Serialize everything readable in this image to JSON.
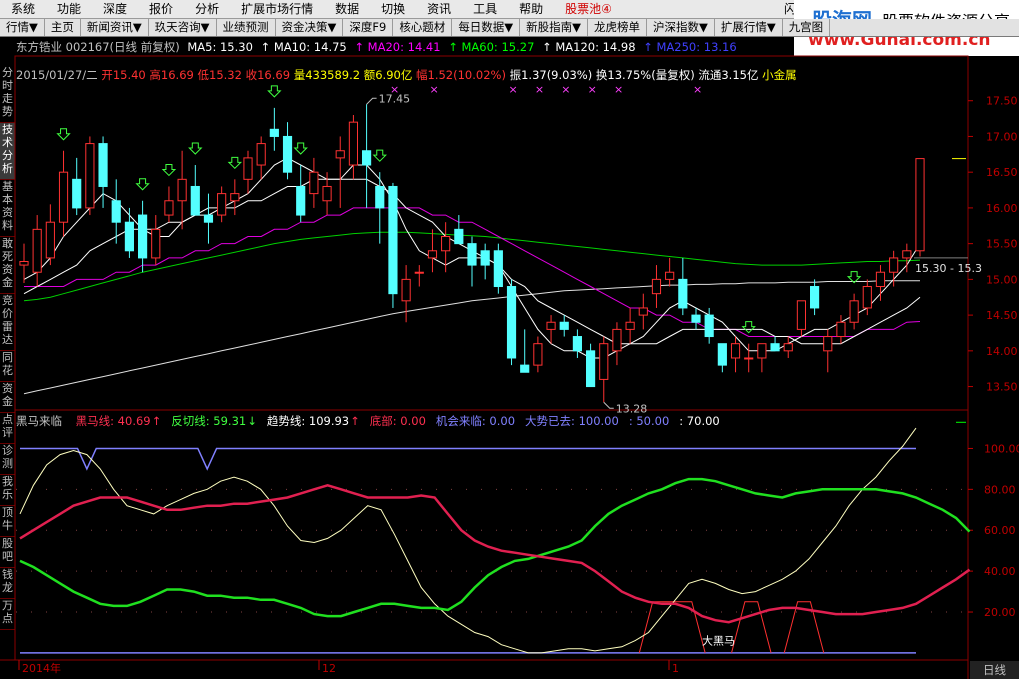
{
  "menubar": {
    "items": [
      "系统",
      "功能",
      "深度",
      "报价",
      "分析",
      "扩展市场行情",
      "数据",
      "切换",
      "资讯",
      "工具",
      "帮助"
    ],
    "stock_pool": "股票池④",
    "flash": "闪电手"
  },
  "logo": {
    "brand": "股海网",
    "tagline": "股票软件资源分享",
    "url": "www.Guhai.com.cn"
  },
  "toolbar": {
    "items": [
      "行情▼",
      "主页",
      "新闻资讯▼",
      "玖天咨询▼",
      "业绩预测",
      "资金决策▼",
      "深度F9",
      "核心题材",
      "每日数据▼",
      "新股指南▼",
      "龙虎榜单",
      "沪深指数▼",
      "扩展行情▼",
      "九宫图"
    ]
  },
  "main_header": {
    "stock": "东方锆业 002167(日线 前复权)",
    "ma": [
      {
        "label": "MA5: 15.30",
        "color": "#ffffff"
      },
      {
        "label": "MA10: 14.75",
        "color": "#ffffff"
      },
      {
        "label": "MA20: 14.41",
        "color": "#ff00ff"
      },
      {
        "label": "MA60: 15.27",
        "color": "#00ff00"
      },
      {
        "label": "MA120: 14.98",
        "color": "#ffffff"
      },
      {
        "label": "MA250: 13.16",
        "color": "#4040ff"
      }
    ]
  },
  "quote_line": {
    "date": "2015/01/27/二",
    "open": "开15.40",
    "high": "高16.69",
    "low": "低15.32",
    "close": "收16.69",
    "vol": "量433589.2",
    "amount": "额6.90亿",
    "change": "幅1.52(10.02%)",
    "amplitude": "振1.37(9.03%)",
    "turnover": "换13.75%(量复权)",
    "float": "流通3.15亿",
    "tag": "小金属"
  },
  "price_axis": [
    "17.50",
    "17.00",
    "16.50",
    "16.00",
    "15.50",
    "15.00",
    "14.50",
    "14.00",
    "13.50"
  ],
  "annotations": {
    "high_mark": "17.45",
    "low_mark": "13.28",
    "last_price": "15.30 - 15.3"
  },
  "indicator_header": {
    "name": "黑马来临",
    "items": [
      {
        "label": "黑马线: 40.69",
        "color": "#ff3050"
      },
      {
        "label": "↑",
        "color": "#ff3050"
      },
      {
        "label": "反切线: 59.31",
        "color": "#40ff40"
      },
      {
        "label": "↓",
        "color": "#40ff40"
      },
      {
        "label": "趋势线: 109.93",
        "color": "#ffffff"
      },
      {
        "label": "↑",
        "color": "#ff3050"
      },
      {
        "label": "底部: 0.00",
        "color": "#ff3050"
      },
      {
        "label": "机会来临: 0.00",
        "color": "#8080ff"
      },
      {
        "label": "大势已去: 100.00",
        "color": "#8080ff"
      },
      {
        "label": ": 50.00",
        "color": "#8080ff"
      },
      {
        "label": ": 70.00",
        "color": "#ffffff"
      }
    ]
  },
  "indicator_axis": [
    "100.00",
    "80.00",
    "60.00",
    "40.00",
    "20.00"
  ],
  "indicator_label": "大黑马",
  "date_axis": [
    "2014年",
    "12",
    "1"
  ],
  "bottom_tab": "日线",
  "sidebar": [
    "分时走势",
    "技术分析",
    "基本资料",
    "敢死资金",
    "竞价雷达",
    "同花",
    "资金",
    "点评",
    "诊测",
    "我乐",
    "顶牛",
    "股吧",
    "钱龙",
    "万点"
  ],
  "colors": {
    "up": "#ff3232",
    "down": "#54ffff",
    "grid": "#800000"
  },
  "chart_data": {
    "type": "candlestick",
    "price_range": [
      13.2,
      17.65
    ],
    "candles": [
      {
        "o": 15.2,
        "h": 15.5,
        "l": 14.95,
        "c": 15.25
      },
      {
        "o": 15.1,
        "h": 15.9,
        "l": 14.9,
        "c": 15.7
      },
      {
        "o": 15.3,
        "h": 16.05,
        "l": 15.2,
        "c": 15.8
      },
      {
        "o": 15.8,
        "h": 16.8,
        "l": 15.6,
        "c": 16.5
      },
      {
        "o": 16.4,
        "h": 16.7,
        "l": 15.9,
        "c": 16.0
      },
      {
        "o": 16.0,
        "h": 17.0,
        "l": 15.9,
        "c": 16.9
      },
      {
        "o": 16.9,
        "h": 17.0,
        "l": 16.0,
        "c": 16.3
      },
      {
        "o": 16.1,
        "h": 16.4,
        "l": 15.5,
        "c": 15.8
      },
      {
        "o": 15.8,
        "h": 16.0,
        "l": 15.3,
        "c": 15.4
      },
      {
        "o": 15.9,
        "h": 16.1,
        "l": 15.1,
        "c": 15.3
      },
      {
        "o": 15.3,
        "h": 15.9,
        "l": 15.2,
        "c": 15.7
      },
      {
        "o": 15.9,
        "h": 16.3,
        "l": 15.8,
        "c": 16.1
      },
      {
        "o": 16.1,
        "h": 16.8,
        "l": 15.7,
        "c": 16.4
      },
      {
        "o": 16.3,
        "h": 16.6,
        "l": 15.9,
        "c": 15.9
      },
      {
        "o": 15.9,
        "h": 16.2,
        "l": 15.5,
        "c": 15.8
      },
      {
        "o": 15.9,
        "h": 16.3,
        "l": 15.8,
        "c": 16.2
      },
      {
        "o": 16.1,
        "h": 16.4,
        "l": 15.9,
        "c": 16.2
      },
      {
        "o": 16.4,
        "h": 16.8,
        "l": 16.2,
        "c": 16.7
      },
      {
        "o": 16.6,
        "h": 17.0,
        "l": 16.4,
        "c": 16.9
      },
      {
        "o": 17.1,
        "h": 17.4,
        "l": 16.8,
        "c": 17.0
      },
      {
        "o": 17.0,
        "h": 17.2,
        "l": 16.4,
        "c": 16.5
      },
      {
        "o": 16.3,
        "h": 16.6,
        "l": 15.8,
        "c": 15.9
      },
      {
        "o": 16.2,
        "h": 16.7,
        "l": 16.0,
        "c": 16.5
      },
      {
        "o": 16.1,
        "h": 16.5,
        "l": 15.9,
        "c": 16.3
      },
      {
        "o": 16.7,
        "h": 17.0,
        "l": 16.0,
        "c": 16.8
      },
      {
        "o": 16.6,
        "h": 17.3,
        "l": 16.4,
        "c": 17.2
      },
      {
        "o": 16.8,
        "h": 17.45,
        "l": 16.0,
        "c": 16.6
      },
      {
        "o": 16.3,
        "h": 16.5,
        "l": 15.5,
        "c": 16.0
      },
      {
        "o": 16.3,
        "h": 16.35,
        "l": 14.6,
        "c": 14.8
      },
      {
        "o": 14.7,
        "h": 15.2,
        "l": 14.4,
        "c": 15.0
      },
      {
        "o": 15.1,
        "h": 15.2,
        "l": 14.9,
        "c": 15.1
      },
      {
        "o": 15.3,
        "h": 15.7,
        "l": 15.1,
        "c": 15.4
      },
      {
        "o": 15.4,
        "h": 15.8,
        "l": 15.1,
        "c": 15.6
      },
      {
        "o": 15.7,
        "h": 15.9,
        "l": 15.5,
        "c": 15.5
      },
      {
        "o": 15.5,
        "h": 15.6,
        "l": 14.9,
        "c": 15.2
      },
      {
        "o": 15.4,
        "h": 15.5,
        "l": 15.0,
        "c": 15.2
      },
      {
        "o": 15.4,
        "h": 15.5,
        "l": 14.8,
        "c": 14.9
      },
      {
        "o": 14.9,
        "h": 15.0,
        "l": 13.8,
        "c": 13.9
      },
      {
        "o": 13.8,
        "h": 14.3,
        "l": 13.7,
        "c": 13.7
      },
      {
        "o": 13.8,
        "h": 14.2,
        "l": 13.7,
        "c": 14.1
      },
      {
        "o": 14.3,
        "h": 14.5,
        "l": 14.1,
        "c": 14.4
      },
      {
        "o": 14.4,
        "h": 14.5,
        "l": 14.2,
        "c": 14.3
      },
      {
        "o": 14.2,
        "h": 14.3,
        "l": 13.9,
        "c": 14.0
      },
      {
        "o": 14.0,
        "h": 14.1,
        "l": 13.5,
        "c": 13.5
      },
      {
        "o": 13.6,
        "h": 14.2,
        "l": 13.28,
        "c": 14.1
      },
      {
        "o": 14.0,
        "h": 14.4,
        "l": 13.8,
        "c": 14.3
      },
      {
        "o": 14.3,
        "h": 14.6,
        "l": 14.1,
        "c": 14.4
      },
      {
        "o": 14.5,
        "h": 14.8,
        "l": 14.3,
        "c": 14.6
      },
      {
        "o": 14.8,
        "h": 15.2,
        "l": 14.6,
        "c": 15.0
      },
      {
        "o": 15.0,
        "h": 15.3,
        "l": 14.9,
        "c": 15.1
      },
      {
        "o": 15.0,
        "h": 15.3,
        "l": 14.5,
        "c": 14.6
      },
      {
        "o": 14.5,
        "h": 14.6,
        "l": 14.3,
        "c": 14.4
      },
      {
        "o": 14.5,
        "h": 14.6,
        "l": 14.1,
        "c": 14.2
      },
      {
        "o": 14.1,
        "h": 14.1,
        "l": 13.7,
        "c": 13.8
      },
      {
        "o": 13.9,
        "h": 14.2,
        "l": 13.7,
        "c": 14.1
      },
      {
        "o": 13.9,
        "h": 14.1,
        "l": 13.7,
        "c": 13.9
      },
      {
        "o": 13.9,
        "h": 14.1,
        "l": 13.7,
        "c": 14.1
      },
      {
        "o": 14.1,
        "h": 14.2,
        "l": 14.0,
        "c": 14.0
      },
      {
        "o": 14.0,
        "h": 14.2,
        "l": 13.9,
        "c": 14.1
      },
      {
        "o": 14.3,
        "h": 14.7,
        "l": 14.2,
        "c": 14.7
      },
      {
        "o": 14.9,
        "h": 15.0,
        "l": 14.5,
        "c": 14.6
      },
      {
        "o": 14.0,
        "h": 14.3,
        "l": 13.7,
        "c": 14.2
      },
      {
        "o": 14.2,
        "h": 14.5,
        "l": 14.1,
        "c": 14.4
      },
      {
        "o": 14.4,
        "h": 14.8,
        "l": 14.3,
        "c": 14.7
      },
      {
        "o": 14.6,
        "h": 15.0,
        "l": 14.5,
        "c": 14.9
      },
      {
        "o": 14.9,
        "h": 15.2,
        "l": 14.7,
        "c": 15.1
      },
      {
        "o": 15.1,
        "h": 15.4,
        "l": 14.9,
        "c": 15.3
      },
      {
        "o": 15.3,
        "h": 15.5,
        "l": 15.1,
        "c": 15.4
      },
      {
        "o": 15.4,
        "h": 16.69,
        "l": 15.32,
        "c": 16.69
      }
    ],
    "ma5": [
      15.0,
      15.1,
      15.3,
      15.6,
      15.8,
      16.0,
      16.2,
      16.1,
      15.9,
      15.7,
      15.6,
      15.6,
      15.8,
      15.9,
      16.0,
      16.0,
      16.1,
      16.2,
      16.4,
      16.6,
      16.7,
      16.6,
      16.5,
      16.4,
      16.4,
      16.6,
      16.6,
      16.4,
      16.1,
      15.7,
      15.4,
      15.3,
      15.2,
      15.3,
      15.3,
      15.3,
      15.2,
      14.9,
      14.6,
      14.3,
      14.1,
      14.0,
      14.0,
      13.9,
      13.9,
      14.0,
      14.1,
      14.2,
      14.4,
      14.6,
      14.7,
      14.6,
      14.5,
      14.4,
      14.2,
      14.0,
      14.0,
      14.0,
      14.1,
      14.2,
      14.3,
      14.3,
      14.4,
      14.5,
      14.6,
      14.8,
      15.0,
      15.2,
      15.5
    ],
    "ma10": [
      14.8,
      14.9,
      15.0,
      15.1,
      15.2,
      15.4,
      15.5,
      15.6,
      15.7,
      15.7,
      15.7,
      15.8,
      15.8,
      15.9,
      15.9,
      16.0,
      16.0,
      16.1,
      16.1,
      16.2,
      16.3,
      16.3,
      16.4,
      16.4,
      16.4,
      16.4,
      16.4,
      16.3,
      16.2,
      16.0,
      15.9,
      15.8,
      15.6,
      15.5,
      15.4,
      15.3,
      15.2,
      15.0,
      14.9,
      14.7,
      14.6,
      14.5,
      14.4,
      14.3,
      14.2,
      14.1,
      14.1,
      14.1,
      14.1,
      14.2,
      14.3,
      14.3,
      14.3,
      14.3,
      14.3,
      14.3,
      14.3,
      14.2,
      14.2,
      14.1,
      14.1,
      14.1,
      14.1,
      14.2,
      14.3,
      14.4,
      14.5,
      14.6,
      14.75
    ],
    "ma20": [
      14.9,
      14.9,
      14.9,
      14.9,
      15.0,
      15.0,
      15.0,
      15.1,
      15.1,
      15.2,
      15.2,
      15.3,
      15.3,
      15.4,
      15.4,
      15.5,
      15.5,
      15.6,
      15.6,
      15.7,
      15.7,
      15.8,
      15.8,
      15.9,
      15.9,
      16.0,
      16.0,
      16.0,
      16.0,
      16.0,
      16.0,
      15.9,
      15.9,
      15.8,
      15.8,
      15.7,
      15.6,
      15.5,
      15.4,
      15.3,
      15.2,
      15.1,
      15.0,
      14.9,
      14.8,
      14.7,
      14.6,
      14.6,
      14.5,
      14.5,
      14.4,
      14.4,
      14.3,
      14.3,
      14.3,
      14.2,
      14.2,
      14.2,
      14.2,
      14.2,
      14.2,
      14.2,
      14.2,
      14.2,
      14.3,
      14.3,
      14.3,
      14.4,
      14.41
    ],
    "ma60": [
      14.7,
      14.72,
      14.75,
      14.8,
      14.85,
      14.9,
      14.95,
      15.0,
      15.05,
      15.1,
      15.14,
      15.18,
      15.22,
      15.26,
      15.3,
      15.34,
      15.38,
      15.42,
      15.46,
      15.5,
      15.53,
      15.56,
      15.58,
      15.6,
      15.62,
      15.64,
      15.65,
      15.66,
      15.66,
      15.66,
      15.65,
      15.64,
      15.63,
      15.62,
      15.61,
      15.6,
      15.58,
      15.56,
      15.54,
      15.52,
      15.5,
      15.48,
      15.46,
      15.44,
      15.42,
      15.4,
      15.38,
      15.36,
      15.34,
      15.32,
      15.3,
      15.28,
      15.26,
      15.24,
      15.22,
      15.21,
      15.2,
      15.2,
      15.2,
      15.2,
      15.21,
      15.22,
      15.23,
      15.24,
      15.25,
      15.25,
      15.26,
      15.26,
      15.27
    ],
    "ma120": [
      13.4,
      13.44,
      13.48,
      13.52,
      13.56,
      13.6,
      13.64,
      13.68,
      13.72,
      13.76,
      13.8,
      13.84,
      13.88,
      13.92,
      13.96,
      14.0,
      14.04,
      14.08,
      14.12,
      14.16,
      14.2,
      14.24,
      14.28,
      14.32,
      14.36,
      14.4,
      14.44,
      14.48,
      14.52,
      14.55,
      14.58,
      14.61,
      14.64,
      14.67,
      14.7,
      14.72,
      14.74,
      14.76,
      14.78,
      14.8,
      14.82,
      14.84,
      14.85,
      14.86,
      14.87,
      14.88,
      14.89,
      14.9,
      14.91,
      14.92,
      14.92,
      14.93,
      14.93,
      14.94,
      14.94,
      14.95,
      14.95,
      14.95,
      14.96,
      14.96,
      14.96,
      14.97,
      14.97,
      14.97,
      14.97,
      14.98,
      14.98,
      14.98,
      14.98
    ],
    "indicator_range": [
      -2,
      110
    ],
    "black_horse": [
      56,
      60,
      64,
      68,
      72,
      74,
      76,
      76,
      76,
      74,
      72,
      70,
      70,
      71,
      72,
      72,
      73,
      73,
      74,
      75,
      76,
      78,
      80,
      82,
      80,
      78,
      76,
      76,
      76,
      76,
      77,
      76,
      68,
      60,
      55,
      52,
      50,
      49,
      48,
      47,
      46,
      45,
      44,
      40,
      35,
      30,
      27,
      25,
      24,
      24,
      22,
      18,
      16,
      15,
      17,
      19,
      21,
      22,
      22,
      21,
      20,
      19,
      19,
      19,
      20,
      21,
      22,
      24,
      28,
      32,
      36,
      40.69
    ],
    "reverse_cut": [
      45,
      42,
      38,
      34,
      30,
      27,
      24,
      23,
      23,
      25,
      28,
      31,
      31,
      30,
      28,
      28,
      27,
      27,
      26,
      26,
      24,
      22,
      19,
      18,
      18,
      20,
      22,
      24,
      24,
      23,
      22,
      22,
      21,
      25,
      32,
      38,
      42,
      45,
      46,
      48,
      50,
      52,
      55,
      62,
      68,
      72,
      75,
      78,
      80,
      83,
      85,
      85,
      84,
      82,
      80,
      78,
      77,
      76,
      78,
      79,
      80,
      80,
      80,
      80,
      80,
      79,
      78,
      76,
      73,
      70,
      66,
      59.31
    ],
    "trend": [
      68,
      82,
      92,
      97,
      99,
      97,
      90,
      80,
      72,
      70,
      68,
      72,
      75,
      78,
      80,
      84,
      86,
      84,
      80,
      72,
      62,
      55,
      54,
      56,
      60,
      66,
      72,
      70,
      58,
      45,
      32,
      24,
      18,
      14,
      10,
      8,
      4,
      2,
      0,
      0,
      1,
      2,
      2,
      1,
      2,
      3,
      6,
      10,
      18,
      26,
      34,
      36,
      34,
      31,
      29,
      30,
      33,
      36,
      40,
      46,
      54,
      62,
      72,
      80,
      86,
      94,
      101,
      109.93
    ],
    "opportunity_hits": [
      [
        47,
        52
      ],
      [
        54,
        57
      ],
      [
        58,
        61
      ]
    ]
  }
}
